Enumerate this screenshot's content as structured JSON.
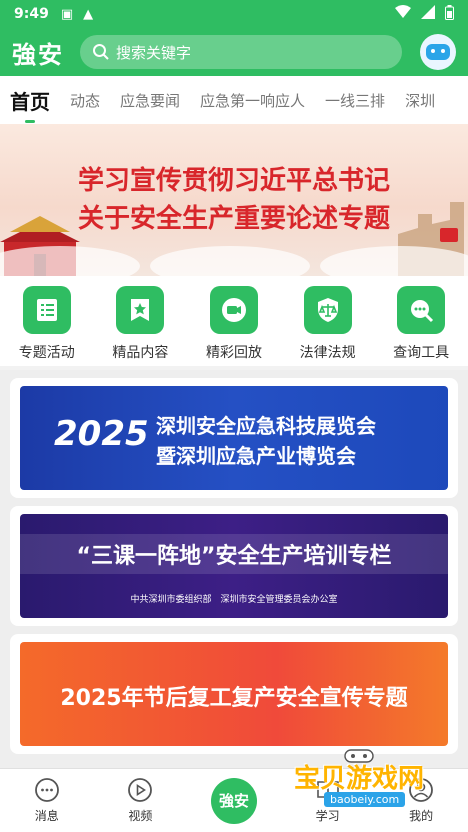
{
  "status_bar": {
    "time": "9:49",
    "icons": [
      "a-badge-icon",
      "warning-icon",
      "wifi-icon",
      "signal-icon",
      "battery-icon"
    ]
  },
  "app_bar": {
    "logo": "強安",
    "search_placeholder": "搜索关键字"
  },
  "tabs": [
    {
      "label": "首页",
      "active": true
    },
    {
      "label": "动态"
    },
    {
      "label": "应急要闻"
    },
    {
      "label": "应急第一响应人"
    },
    {
      "label": "一线三排"
    },
    {
      "label": "深圳"
    }
  ],
  "banner": {
    "line1": "学习宣传贯彻习近平总书记",
    "line2": "关于安全生产重要论述专题"
  },
  "quick_links": [
    {
      "label": "专题活动",
      "icon": "list-icon"
    },
    {
      "label": "精品内容",
      "icon": "star-bookmark-icon"
    },
    {
      "label": "精彩回放",
      "icon": "video-icon"
    },
    {
      "label": "法律法规",
      "icon": "scale-shield-icon"
    },
    {
      "label": "查询工具",
      "icon": "search-chat-icon"
    }
  ],
  "cards": [
    {
      "year": "2025",
      "title1": "深圳安全应急科技展览会",
      "title2": "暨深圳应急产业博览会"
    },
    {
      "title": "“三课一阵地”安全生产培训专栏",
      "sub": "中共深圳市委组织部　深圳市安全管理委员会办公室"
    },
    {
      "title": "2025年节后复工复产安全宣传专题"
    }
  ],
  "bottom_nav": [
    {
      "label": "消息",
      "icon": "message-icon"
    },
    {
      "label": "视频",
      "icon": "play-icon"
    },
    {
      "label": "強安",
      "icon": "center-logo"
    },
    {
      "label": "学习",
      "icon": "book-icon"
    },
    {
      "label": "我的",
      "icon": "user-icon"
    }
  ],
  "watermark": {
    "text": "宝贝游戏网",
    "url": "baobeiy.com"
  },
  "colors": {
    "primary": "#2fbd62",
    "banner_text": "#d8262b"
  }
}
